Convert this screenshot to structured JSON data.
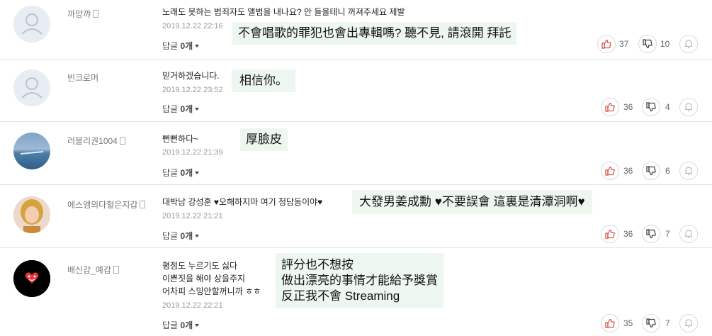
{
  "comments": [
    {
      "nickname": "까망꺄",
      "body_lines": [
        "노래도 못하는 범죄자도 앨범을 내나요? 안 들을테니 꺼져주세요 제발"
      ],
      "date": "2019.12.22  22:16",
      "reply_label": "답글",
      "reply_count": "0개",
      "translation_lines": [
        "不會唱歌的罪犯也會出專輯嗎? 聽不見, 請滾開 拜託"
      ],
      "likes": "37",
      "dislikes": "10",
      "avatar": "default"
    },
    {
      "nickname": "빈크로머",
      "body_lines": [
        "믿거하겠습니다."
      ],
      "date": "2019.12.22  23:52",
      "reply_label": "답글",
      "reply_count": "0개",
      "translation_lines": [
        "相信你。"
      ],
      "likes": "36",
      "dislikes": "4",
      "avatar": "default"
    },
    {
      "nickname": "러블리권1004",
      "body_lines": [
        "뻔뻔하다~"
      ],
      "date": "2019.12.22  21:39",
      "reply_label": "답글",
      "reply_count": "0개",
      "translation_lines": [
        "厚臉皮"
      ],
      "likes": "36",
      "dislikes": "6",
      "avatar": "sea"
    },
    {
      "nickname": "에스엠의다헐은지갑",
      "body_lines": [
        "대박남 강성훈 ♥오해하지마 여기 청담동이야♥"
      ],
      "date": "2019.12.22  21:21",
      "reply_label": "답글",
      "reply_count": "0개",
      "translation_lines": [
        "大發男姜成勳 ♥不要誤會 這裏是清潭洞啊♥"
      ],
      "likes": "36",
      "dislikes": "7",
      "avatar": "person"
    },
    {
      "nickname": "배신감_예감",
      "body_lines": [
        "평점도 누르기도 싫다",
        "이쁜짓을 해야 상을주지",
        "어차피 스밍안할꺼니까 ㅎㅎ"
      ],
      "date": "2019.12.22  22:21",
      "reply_label": "답글",
      "reply_count": "0개",
      "translation_lines": [
        "評分也不想按",
        "做出漂亮的事情才能給予獎賞",
        "反正我不會 Streaming"
      ],
      "likes": "35",
      "dislikes": "7",
      "avatar": "logo"
    }
  ],
  "icons": {
    "like": "thumbs-up-icon",
    "dislike": "thumbs-down-icon",
    "report": "bell-icon",
    "phone": "mobile-phone-icon"
  },
  "colors": {
    "like": "#d9534f",
    "dislike": "#444444",
    "translation_bg": "#eef7ef"
  }
}
